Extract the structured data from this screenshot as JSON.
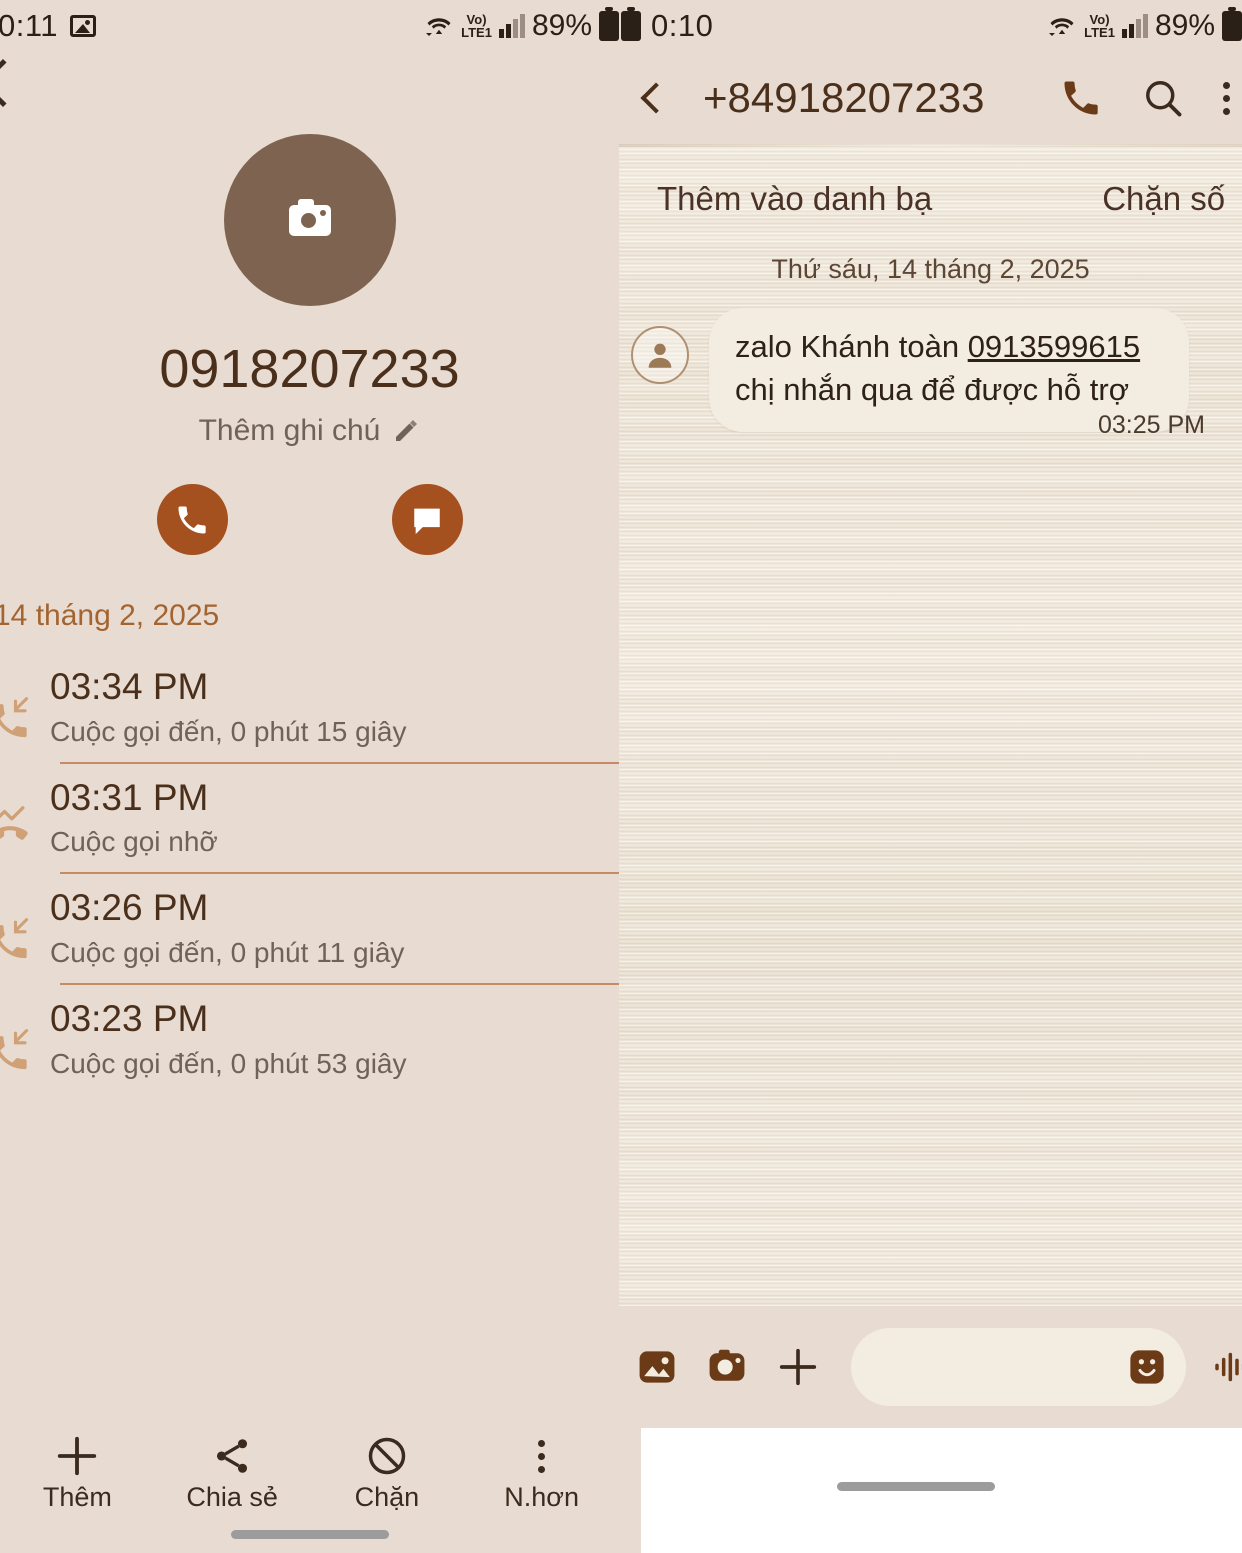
{
  "left_panel": {
    "status_bar": {
      "time": "0:11",
      "network": "LTE1",
      "volte": "Vo)",
      "battery_pct": "89%",
      "photo_icon": "photo-icon"
    },
    "back_icon": "back-chevron-icon",
    "profile": {
      "avatar_icon": "camera-icon",
      "phone_number": "0918207233",
      "note_label": "Thêm ghi chú",
      "note_icon": "pencil-icon"
    },
    "actions": [
      {
        "name": "call",
        "icon": "phone-icon"
      },
      {
        "name": "message",
        "icon": "message-icon"
      }
    ],
    "call_log": {
      "date_header": "14 tháng 2, 2025",
      "entries": [
        {
          "time": "03:34 PM",
          "detail": "Cuộc gọi đến, 0 phút 15 giây",
          "icon": "incoming-call-icon"
        },
        {
          "time": "03:31 PM",
          "detail": "Cuộc gọi nhỡ",
          "icon": "missed-call-icon"
        },
        {
          "time": "03:26 PM",
          "detail": "Cuộc gọi đến, 0 phút 11 giây",
          "icon": "incoming-call-icon"
        },
        {
          "time": "03:23 PM",
          "detail": "Cuộc gọi đến, 0 phút 53 giây",
          "icon": "incoming-call-icon"
        }
      ]
    },
    "bottom_bar": [
      {
        "label": "Thêm",
        "icon": "plus-icon"
      },
      {
        "label": "Chia sẻ",
        "icon": "share-icon"
      },
      {
        "label": "Chặn",
        "icon": "block-icon"
      },
      {
        "label": "N.hơn",
        "icon": "more-vertical-icon"
      }
    ]
  },
  "right_panel": {
    "status_bar": {
      "time": "0:10",
      "network": "LTE1",
      "volte": "Vo)",
      "battery_pct": "89%"
    },
    "header": {
      "back_icon": "back-chevron-icon",
      "title": "+84918207233",
      "call_icon": "phone-icon",
      "search_icon": "search-icon",
      "menu_icon": "more-vertical-icon"
    },
    "quick_actions": {
      "add_contact": "Thêm vào danh bạ",
      "block_number": "Chặn số"
    },
    "conversation": {
      "date_separator": "Thứ sáu, 14 tháng 2, 2025",
      "messages": [
        {
          "sender_avatar": "person-avatar-icon",
          "text_before": "zalo Khánh toàn ",
          "link": "0913599615",
          "text_after": " chị nhắn qua để được hỗ trợ",
          "time": "03:25 PM"
        }
      ]
    },
    "composer": {
      "gallery_icon": "gallery-icon",
      "camera_icon": "camera-icon",
      "add_icon": "plus-icon",
      "input_value": "",
      "input_placeholder": "",
      "sticker_icon": "sticker-icon",
      "voice_icon": "voice-waveform-icon"
    }
  },
  "colors": {
    "bg_beige": "#e8dbd2",
    "accent_orange": "#a4501f",
    "text_brown": "#4a2f1b",
    "muted_brown": "#6f6258",
    "divider": "#b9703f",
    "date_orange": "#a4642f",
    "wood_bg": "#efe7da"
  }
}
